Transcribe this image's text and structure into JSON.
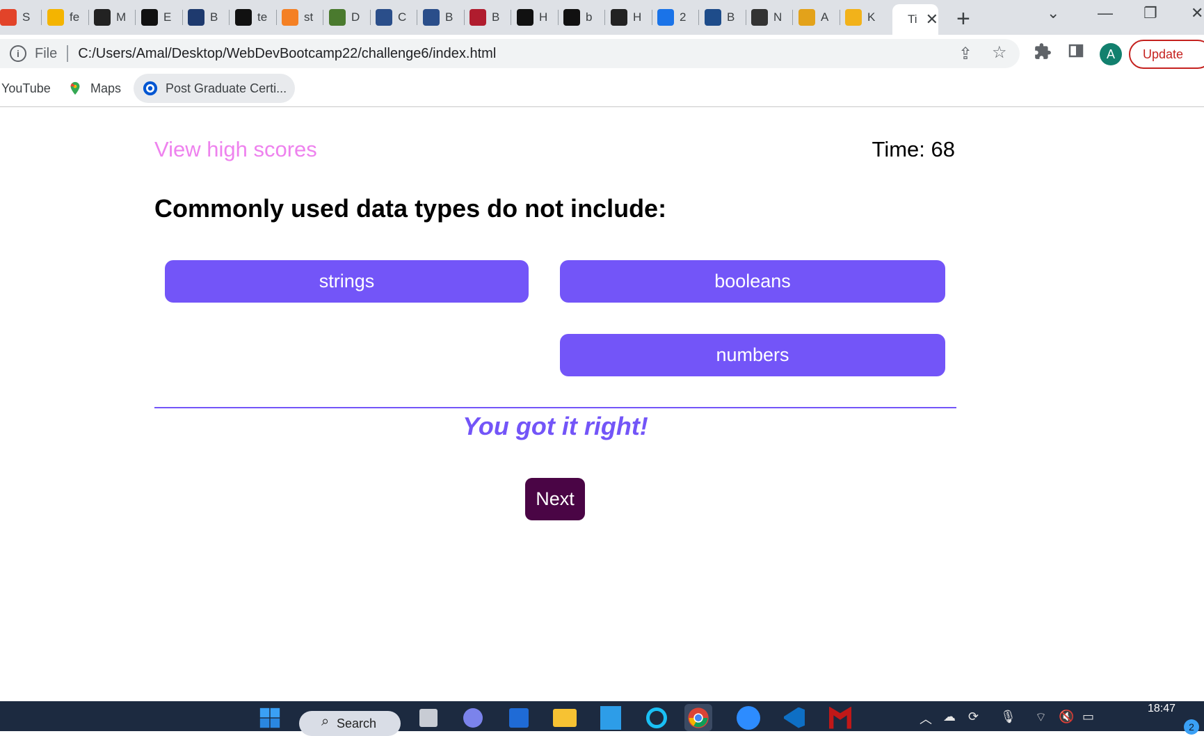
{
  "browser": {
    "tabs": [
      {
        "title": "S",
        "icon": "gitlab-icon",
        "color": "#e24329"
      },
      {
        "title": "fe",
        "icon": "slides-icon",
        "color": "#f4b400"
      },
      {
        "title": "M",
        "icon": "edx-icon",
        "color": "#222222"
      },
      {
        "title": "E",
        "icon": "github-icon",
        "color": "#111111"
      },
      {
        "title": "B",
        "icon": "shield-icon",
        "color": "#1e3a6e"
      },
      {
        "title": "te",
        "icon": "codepen-icon",
        "color": "#111111"
      },
      {
        "title": "st",
        "icon": "stackoverflow-icon",
        "color": "#f48024"
      },
      {
        "title": "D",
        "icon": "bracket-icon",
        "color": "#4a7a2e"
      },
      {
        "title": "C",
        "icon": "crown-icon",
        "color": "#2a4e8a"
      },
      {
        "title": "B",
        "icon": "crown-icon",
        "color": "#2a4e8a"
      },
      {
        "title": "B",
        "icon": "seal-icon",
        "color": "#b01c2e"
      },
      {
        "title": "H",
        "icon": "github-icon",
        "color": "#111111"
      },
      {
        "title": "b",
        "icon": "github-icon",
        "color": "#111111"
      },
      {
        "title": "H",
        "icon": "hexagon-icon",
        "color": "#222222"
      },
      {
        "title": "2",
        "icon": "search-icon",
        "color": "#1a73e8"
      },
      {
        "title": "B",
        "icon": "tile-icon",
        "color": "#1e4c8a"
      },
      {
        "title": "N",
        "icon": "horse-icon",
        "color": "#333333"
      },
      {
        "title": "A",
        "icon": "people-icon",
        "color": "#e3a21a"
      },
      {
        "title": "K",
        "icon": "sun-icon",
        "color": "#f2b21a"
      }
    ],
    "active_tab_title": "Ti",
    "address": {
      "scheme_label": "File",
      "url": "C:/Users/Amal/Desktop/WebDevBootcamp22/challenge6/index.html"
    },
    "profile_initial": "A",
    "update_label": "Update",
    "bookmarks": [
      {
        "label": "YouTube"
      },
      {
        "label": "Maps"
      },
      {
        "label": "Post Graduate Certi..."
      }
    ]
  },
  "quiz": {
    "high_scores_link": "View high scores",
    "timer_text": "Time: 68",
    "question": "Commonly used data types do not include:",
    "answers": [
      "strings",
      "booleans",
      "numbers"
    ],
    "feedback": "You got it right!",
    "next_label": "Next",
    "colors": {
      "accent": "#7355f8",
      "link": "#ee82ee",
      "next": "#4a0545"
    }
  },
  "taskbar": {
    "search_label": "Search",
    "clock_time": "18:47",
    "notification_count": "2"
  }
}
